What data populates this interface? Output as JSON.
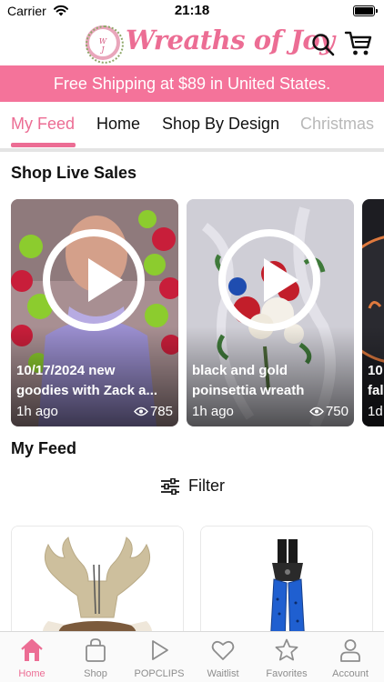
{
  "status_bar": {
    "carrier": "Carrier",
    "time": "21:18"
  },
  "header": {
    "brand": "Wreaths of Joy",
    "brand_icon": "wreath-logo-icon",
    "search_icon": "search-icon",
    "cart_icon": "cart-icon"
  },
  "promo": {
    "text": "Free Shipping at $89 in United States."
  },
  "nav_tabs": [
    {
      "label": "My Feed",
      "active": true
    },
    {
      "label": "Home"
    },
    {
      "label": "Shop By Design"
    },
    {
      "label": "Christmas"
    }
  ],
  "live_section": {
    "title": "Shop Live Sales",
    "items": [
      {
        "title_line1": "10/17/2024 new",
        "title_line2": "goodies with Zack a...",
        "time": "1h ago",
        "views": "785"
      },
      {
        "title_line1": "black and gold",
        "title_line2": "poinsettia wreath",
        "time": "1h ago",
        "views": "750"
      },
      {
        "title_line1": "10",
        "title_line2": "fal",
        "time": "1d"
      }
    ]
  },
  "feed": {
    "title": "My Feed",
    "filter_label": "Filter"
  },
  "bottom_tabs": [
    {
      "label": "Home",
      "icon": "home-icon",
      "active": true
    },
    {
      "label": "Shop",
      "icon": "shopping-bag-icon"
    },
    {
      "label": "POPCLIPS",
      "icon": "play-icon"
    },
    {
      "label": "Waitlist",
      "icon": "heart-icon"
    },
    {
      "label": "Favorites",
      "icon": "star-icon"
    },
    {
      "label": "Account",
      "icon": "person-icon"
    }
  ],
  "colors": {
    "brand_pink": "#ec6d94",
    "promo_bg": "#f4739a"
  }
}
